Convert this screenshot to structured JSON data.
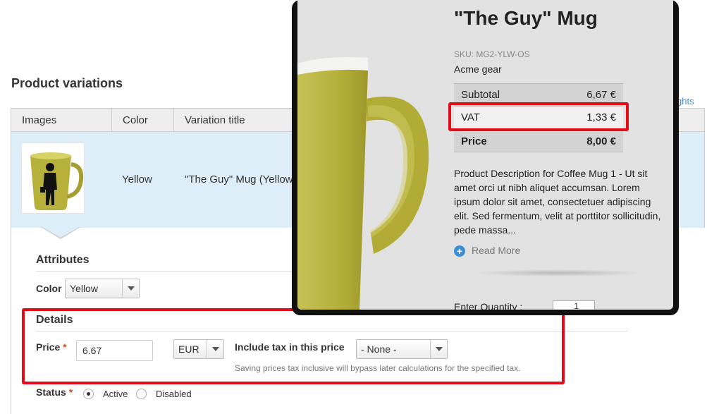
{
  "page": {
    "section_title": "Product variations",
    "right_link_fragment": "ghts"
  },
  "table": {
    "headers": [
      "Images",
      "Color",
      "Variation title"
    ],
    "row": {
      "color": "Yellow",
      "variation_title": "\"The Guy\" Mug (Yellow"
    }
  },
  "attributes": {
    "title": "Attributes",
    "color_label": "Color",
    "color_value": "Yellow"
  },
  "details": {
    "title": "Details",
    "price_label": "Price",
    "required_mark": "*",
    "price_value": "6.67",
    "currency": "EUR",
    "include_tax_label": "Include tax in this price",
    "include_tax_value": "- None -",
    "hint": "Saving prices tax inclusive will bypass later calculations for the specified tax."
  },
  "status": {
    "label": "Status",
    "required_mark": "*",
    "options": [
      {
        "label": "Active",
        "selected": true
      },
      {
        "label": "Disabled",
        "selected": false
      }
    ]
  },
  "popup": {
    "title": "\"The Guy\" Mug",
    "sku": "SKU: MG2-YLW-OS",
    "brand": "Acme gear",
    "prices": [
      {
        "label": "Subtotal",
        "value": "6,67 €"
      },
      {
        "label": "VAT",
        "value": "1,33 €"
      },
      {
        "label": "Price",
        "value": "8,00 €"
      }
    ],
    "description": "Product Description for Coffee Mug 1 - Ut sit amet orci ut nibh aliquet accumsan. Lorem ipsum dolor sit amet, consectetuer adipiscing elit. Sed fermentum, velit at porttitor sollicitudin, pede massa...",
    "read_more": "Read More",
    "quantity_label": "Enter Quantity :",
    "quantity_value": "1"
  },
  "colors": {
    "highlight": "#e30b17",
    "row_selected": "#ddeef8",
    "mug": "#b7b13b",
    "link_blue": "#3b8ed6"
  }
}
